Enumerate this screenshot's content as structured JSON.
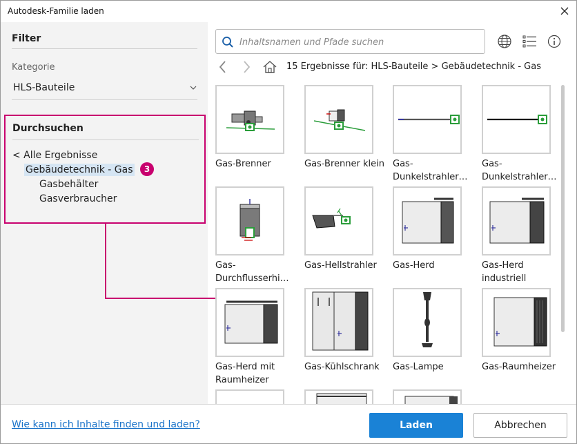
{
  "window": {
    "title": "Autodesk-Familie laden"
  },
  "filter": {
    "title": "Filter",
    "category_label": "Kategorie",
    "category_value": "HLS-Bauteile"
  },
  "browse": {
    "title": "Durchsuchen",
    "items": [
      {
        "label": "< Alle Ergebnisse"
      },
      {
        "label": "Gebäudetechnik - Gas",
        "selected": true
      },
      {
        "label": "Gasbehälter"
      },
      {
        "label": "Gasverbraucher"
      }
    ],
    "callout_number": "3"
  },
  "search": {
    "placeholder": "Inhaltsnamen und Pfade suchen"
  },
  "toolbar": {
    "icons": [
      "globe-icon",
      "list-view-icon",
      "info-icon"
    ]
  },
  "breadcrumb": "15 Ergebnisse für: HLS-Bauteile > Gebäudetechnik - Gas",
  "results": [
    {
      "label": "Gas-Brenner",
      "kind": "burner"
    },
    {
      "label": "Gas-Brenner klein",
      "kind": "burner-small"
    },
    {
      "label": "Gas-Dunkelstrahler…",
      "kind": "radiant"
    },
    {
      "label": "Gas-Dunkelstrahler…",
      "kind": "radiant"
    },
    {
      "label": "Gas-Durchflusserhi…",
      "kind": "heater"
    },
    {
      "label": "Gas-Hellstrahler",
      "kind": "light-radiant"
    },
    {
      "label": "Gas-Herd",
      "kind": "stove"
    },
    {
      "label": "Gas-Herd industriell",
      "kind": "stove"
    },
    {
      "label": "Gas-Herd mit Raumheizer",
      "kind": "stove"
    },
    {
      "label": "Gas-Kühlschrank",
      "kind": "fridge"
    },
    {
      "label": "Gas-Lampe",
      "kind": "lamp"
    },
    {
      "label": "Gas-Raumheizer",
      "kind": "room-heater"
    },
    {
      "label": "",
      "kind": "partial"
    },
    {
      "label": "",
      "kind": "partial-cabinet"
    },
    {
      "label": "",
      "kind": "partial-box"
    }
  ],
  "footer": {
    "help_link": "Wie kann ich Inhalte finden und laden?",
    "load_button": "Laden",
    "cancel_button": "Abbrechen"
  },
  "colors": {
    "accent": "#1a82d6",
    "callout": "#c8006e",
    "link": "#1a73c9",
    "selection": "#d5e5f3"
  }
}
